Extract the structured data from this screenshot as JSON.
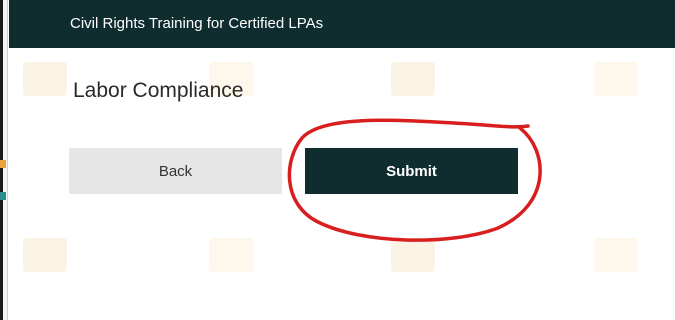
{
  "header": {
    "title": "Civil Rights Training for Certified LPAs"
  },
  "section": {
    "title": "Labor Compliance"
  },
  "buttons": {
    "back_label": "Back",
    "submit_label": "Submit"
  },
  "colors": {
    "header_bg": "#0f2c2e",
    "submit_bg": "#0f2c2e",
    "back_bg": "#e6e6e6",
    "annotation": "#d81e1e"
  }
}
